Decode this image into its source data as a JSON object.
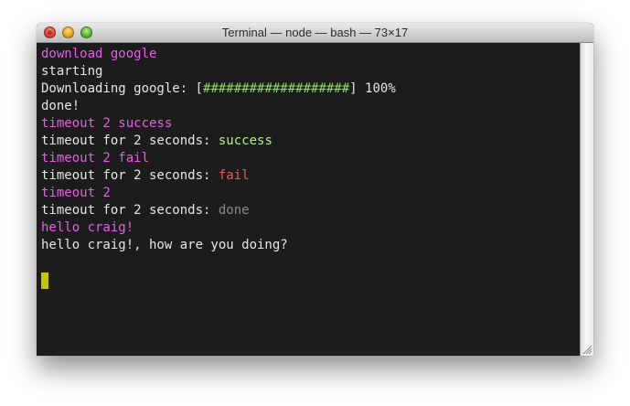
{
  "window": {
    "title": "Terminal — node — bash — 73×17"
  },
  "terminal": {
    "lines": [
      {
        "text": "download google"
      },
      {
        "text": "starting"
      },
      {
        "prefix": "Downloading google: ",
        "bar_open": "[",
        "bar": "###################",
        "bar_close": "]",
        "suffix": " 100%"
      },
      {
        "text": "done!"
      },
      {
        "text": "timeout 2 success"
      },
      {
        "prefix": "timeout for 2 seconds: ",
        "status": "success"
      },
      {
        "text": "timeout 2 fail"
      },
      {
        "prefix": "timeout for 2 seconds: ",
        "status": "fail"
      },
      {
        "text": "timeout 2"
      },
      {
        "prefix": "timeout for 2 seconds: ",
        "status": "done"
      },
      {
        "text": "hello craig!"
      },
      {
        "text": "hello craig!, how are you doing?"
      }
    ]
  },
  "colors": {
    "background": "#1c1c1c",
    "command": "#e65ee6",
    "output": "#e6e6e6",
    "success": "#b6f27a",
    "fail": "#f4575b",
    "done": "#8a8a8a",
    "progress": "#8ce05a",
    "cursor": "#c8c500"
  },
  "icons": {
    "close": "close-button-icon",
    "minimize": "minimize-button-icon",
    "zoom": "zoom-button-icon",
    "toolbar": "toolbar-toggle-icon",
    "resize": "resize-grip-icon"
  }
}
